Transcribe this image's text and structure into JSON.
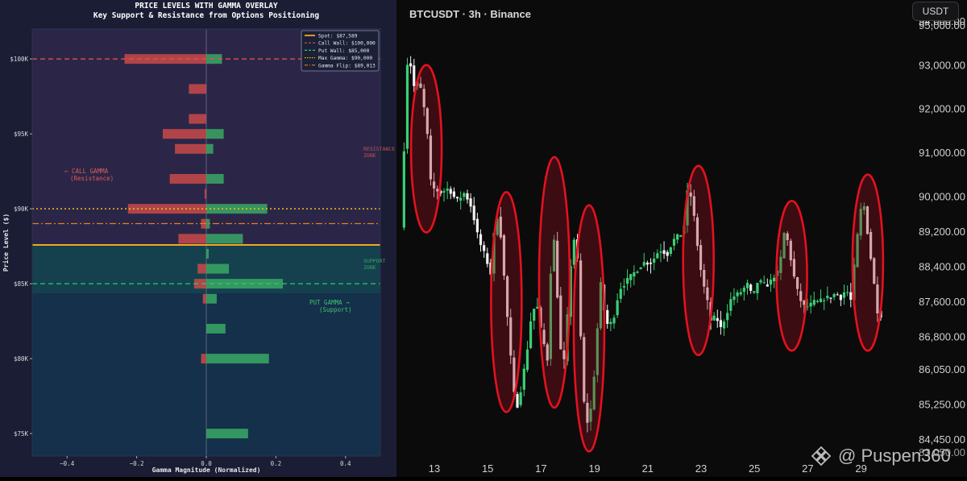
{
  "left_chart": {
    "title": "PRICE LEVELS WITH GAMMA OVERLAY",
    "subtitle": "Key Support & Resistance from Options Positioning",
    "xlabel": "Gamma Magnitude (Normalized)",
    "ylabel": "Price Level ($)",
    "annotations": {
      "call_gamma": "← CALL GAMMA",
      "call_gamma_sub": "(Resistance)",
      "put_gamma": "PUT GAMMA →",
      "put_gamma_sub": "(Support)",
      "resistance": "RESISTANCE",
      "resistance_zone": "ZONE",
      "support": "SUPPORT",
      "support_zone": "ZONE"
    },
    "legend": [
      {
        "label": "Spot: $87,589",
        "color": "#f5a623",
        "style": "solid"
      },
      {
        "label": "Call Wall: $100,000",
        "color": "#e05050",
        "style": "dashed"
      },
      {
        "label": "Put Wall: $85,000",
        "color": "#2ecc71",
        "style": "dashed"
      },
      {
        "label": "Max Gamma: $90,000",
        "color": "#f1c40f",
        "style": "dotted"
      },
      {
        "label": "Gamma Flip: $89,013",
        "color": "#e67e22",
        "style": "dashdot"
      }
    ],
    "colors": {
      "call": "#c94a4a",
      "put": "#3aa865",
      "spot": "#f5a623"
    }
  },
  "right_chart": {
    "title": "BTCUSDT · 3h · Binance",
    "currency_button": "USDT",
    "watermark": "@ Puspen360"
  },
  "chart_data": [
    {
      "type": "bar",
      "orientation": "horizontal",
      "title": "PRICE LEVELS WITH GAMMA OVERLAY",
      "subtitle": "Key Support & Resistance from Options Positioning",
      "xlabel": "Gamma Magnitude (Normalized)",
      "ylabel": "Price Level ($)",
      "xlim": [
        -0.5,
        0.5
      ],
      "ylim": [
        73500,
        102000
      ],
      "xticks": [
        -0.4,
        -0.2,
        0.0,
        0.2,
        0.4
      ],
      "xtick_labels": [
        "−0.4",
        "−0.2",
        "0.0",
        "0.2",
        "0.4"
      ],
      "yticks": [
        75000,
        80000,
        85000,
        90000,
        95000,
        100000
      ],
      "ytick_labels": [
        "$75K",
        "$80K",
        "$85K",
        "$90K",
        "$95K",
        "$100K"
      ],
      "series": [
        {
          "name": "Call",
          "color": "#c94a4a",
          "points": [
            [
              100000,
              -0.235
            ],
            [
              98000,
              -0.05
            ],
            [
              96000,
              -0.05
            ],
            [
              95000,
              -0.125
            ],
            [
              94000,
              -0.09
            ],
            [
              92000,
              -0.105
            ],
            [
              91000,
              -0.005
            ],
            [
              90000,
              -0.225
            ],
            [
              89000,
              -0.015
            ],
            [
              88000,
              -0.08
            ],
            [
              86000,
              -0.025
            ],
            [
              85000,
              -0.035
            ],
            [
              84000,
              -0.01
            ],
            [
              80000,
              -0.015
            ]
          ]
        },
        {
          "name": "Put",
          "color": "#3aa865",
          "points": [
            [
              100000,
              0.045
            ],
            [
              95000,
              0.05
            ],
            [
              94000,
              0.02
            ],
            [
              92000,
              0.05
            ],
            [
              90000,
              0.175
            ],
            [
              89000,
              0.01
            ],
            [
              88000,
              0.105
            ],
            [
              87000,
              0.007
            ],
            [
              86000,
              0.065
            ],
            [
              85000,
              0.22
            ],
            [
              84000,
              0.03
            ],
            [
              82000,
              0.055
            ],
            [
              80000,
              0.18
            ],
            [
              75000,
              0.12
            ]
          ]
        }
      ],
      "lines": [
        {
          "label": "Spot: $87,589",
          "y": 87589
        },
        {
          "label": "Call Wall: $100,000",
          "y": 100000
        },
        {
          "label": "Put Wall: $85,000",
          "y": 85000
        },
        {
          "label": "Max Gamma: $90,000",
          "y": 90000
        },
        {
          "label": "Gamma Flip: $89,013",
          "y": 89013
        }
      ],
      "zones": {
        "resistance": [
          87589,
          102000
        ],
        "support": [
          73500,
          87589
        ]
      },
      "legend_position": "top-right",
      "grid": false
    },
    {
      "type": "candlestick",
      "title": "BTCUSDT · 3h · Binance",
      "ylim": [
        83000,
        95000
      ],
      "yticks": [
        84450,
        85250,
        86050,
        86800,
        87600,
        88400,
        89200,
        90000,
        91000,
        92000,
        93000,
        94000
      ],
      "ytick_labels": [
        "84,450.00",
        "85,250.00",
        "86,050.00",
        "86,800.00",
        "87,600.00",
        "88,400.00",
        "89,200.00",
        "90,000.00",
        "91,000.00",
        "92,000.00",
        "93,000.00",
        "94,000.00"
      ],
      "top_partial_label": "95,000.00",
      "bottom_partial_label": "83,050.00",
      "x_ticks": [
        "13",
        "15",
        "17",
        "19",
        "21",
        "23",
        "25",
        "27",
        "29"
      ],
      "x_range": [
        11.8,
        30.0
      ],
      "path": [
        [
          11.8,
          89300
        ],
        [
          11.9,
          90600
        ],
        [
          12.0,
          92600
        ],
        [
          12.1,
          93500
        ],
        [
          12.25,
          92500
        ],
        [
          12.45,
          92600
        ],
        [
          12.6,
          92400
        ],
        [
          12.8,
          91400
        ],
        [
          12.9,
          90400
        ],
        [
          13.0,
          90200
        ],
        [
          13.3,
          90100
        ],
        [
          13.6,
          90200
        ],
        [
          13.9,
          89900
        ],
        [
          14.2,
          90100
        ],
        [
          14.5,
          89700
        ],
        [
          14.6,
          89300
        ],
        [
          14.8,
          88900
        ],
        [
          15.0,
          88600
        ],
        [
          15.2,
          88200
        ],
        [
          15.35,
          89600
        ],
        [
          15.5,
          89500
        ],
        [
          15.7,
          88000
        ],
        [
          15.9,
          86500
        ],
        [
          16.05,
          85500
        ],
        [
          16.2,
          85200
        ],
        [
          16.35,
          85800
        ],
        [
          16.5,
          86300
        ],
        [
          16.7,
          87300
        ],
        [
          16.9,
          87600
        ],
        [
          17.0,
          87100
        ],
        [
          17.15,
          86700
        ],
        [
          17.3,
          86300
        ],
        [
          17.5,
          89500
        ],
        [
          17.65,
          88000
        ],
        [
          17.8,
          86500
        ],
        [
          17.95,
          86200
        ],
        [
          18.1,
          87800
        ],
        [
          18.25,
          89100
        ],
        [
          18.4,
          88900
        ],
        [
          18.55,
          86800
        ],
        [
          18.7,
          85000
        ],
        [
          18.85,
          84800
        ],
        [
          19.0,
          85500
        ],
        [
          19.15,
          86800
        ],
        [
          19.3,
          88000
        ],
        [
          19.45,
          87300
        ],
        [
          19.6,
          87000
        ],
        [
          19.8,
          87300
        ],
        [
          20.0,
          87900
        ],
        [
          20.3,
          88100
        ],
        [
          20.6,
          88300
        ],
        [
          20.9,
          88500
        ],
        [
          21.2,
          88500
        ],
        [
          21.5,
          88800
        ],
        [
          21.8,
          88700
        ],
        [
          22.0,
          89000
        ],
        [
          22.2,
          89100
        ],
        [
          22.4,
          89200
        ],
        [
          22.55,
          90100
        ],
        [
          22.7,
          90000
        ],
        [
          22.85,
          89300
        ],
        [
          23.0,
          88500
        ],
        [
          23.15,
          88000
        ],
        [
          23.3,
          87600
        ],
        [
          23.45,
          87100
        ],
        [
          23.6,
          87300
        ],
        [
          23.8,
          87000
        ],
        [
          24.0,
          87300
        ],
        [
          24.2,
          87700
        ],
        [
          24.5,
          87800
        ],
        [
          24.8,
          88000
        ],
        [
          25.0,
          87700
        ],
        [
          25.2,
          88100
        ],
        [
          25.4,
          88000
        ],
        [
          25.6,
          88000
        ],
        [
          25.8,
          88200
        ],
        [
          26.0,
          88300
        ],
        [
          26.15,
          89200
        ],
        [
          26.3,
          89000
        ],
        [
          26.45,
          88500
        ],
        [
          26.6,
          88000
        ],
        [
          26.75,
          87700
        ],
        [
          26.9,
          87500
        ],
        [
          27.1,
          87500
        ],
        [
          27.3,
          87600
        ],
        [
          27.5,
          87600
        ],
        [
          27.7,
          87700
        ],
        [
          27.9,
          87700
        ],
        [
          28.1,
          87800
        ],
        [
          28.3,
          87700
        ],
        [
          28.5,
          87900
        ],
        [
          28.7,
          87600
        ],
        [
          28.8,
          88400
        ],
        [
          28.9,
          89000
        ],
        [
          29.05,
          89700
        ],
        [
          29.2,
          89800
        ],
        [
          29.35,
          88900
        ],
        [
          29.5,
          88300
        ],
        [
          29.6,
          87700
        ],
        [
          29.7,
          87300
        ]
      ],
      "highlights": [
        {
          "x_center": 12.7,
          "price_top": 92900,
          "price_bottom": 89300
        },
        {
          "x_center": 15.7,
          "price_top": 90000,
          "price_bottom": 85200
        },
        {
          "x_center": 17.5,
          "price_top": 90800,
          "price_bottom": 85300
        },
        {
          "x_center": 18.8,
          "price_top": 89700,
          "price_bottom": 84300
        },
        {
          "x_center": 22.9,
          "price_top": 90600,
          "price_bottom": 86500
        },
        {
          "x_center": 26.4,
          "price_top": 89800,
          "price_bottom": 86600
        },
        {
          "x_center": 29.25,
          "price_top": 90400,
          "price_bottom": 86600
        }
      ]
    }
  ]
}
